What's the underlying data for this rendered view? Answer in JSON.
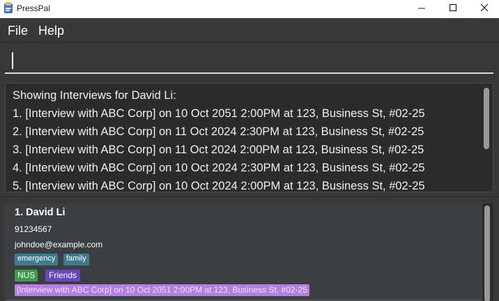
{
  "window": {
    "title": "PressPal"
  },
  "menu": {
    "items": [
      "File",
      "Help"
    ]
  },
  "command": {
    "value": "",
    "placeholder": ""
  },
  "result": {
    "lines": [
      "Showing Interviews for David Li:",
      " 1. [Interview with ABC Corp] on 10 Oct 2051 2:00PM at 123, Business St, #02-25",
      "2. [Interview with ABC Corp] on 11 Oct 2024 2:30PM at 123, Business St, #02-25",
      "3. [Interview with ABC Corp] on 11 Oct 2024 2:00PM at 123, Business St, #02-25",
      "4. [Interview with ABC Corp] on 10 Oct 2024 2:30PM at 123, Business St, #02-25",
      "5. [Interview with ABC Corp] on 10 Oct 2024 2:00PM at 123, Business St, #02-25"
    ]
  },
  "person": {
    "name": "1. David Li",
    "phone": "91234567",
    "email": "johndoe@example.com",
    "tags": [
      "emergency",
      "family"
    ],
    "groups": [
      "NUS",
      "Friends"
    ],
    "interview": "[Interview with ABC Corp] on 10 Oct 2051 2:00PM at 123, Business St, #02-25"
  },
  "colors": {
    "background": "#383838",
    "panel": "#2b2b2b",
    "card": "#3c3f41",
    "tag_blue": "#3e7b91",
    "tag_green": "#3c9a49",
    "tag_purple": "#6349bc",
    "tag_lilac": "#b47ee0"
  },
  "icons": {
    "app": "app-icon",
    "minimize": "minimize-icon",
    "maximize": "maximize-icon",
    "close": "close-icon"
  }
}
